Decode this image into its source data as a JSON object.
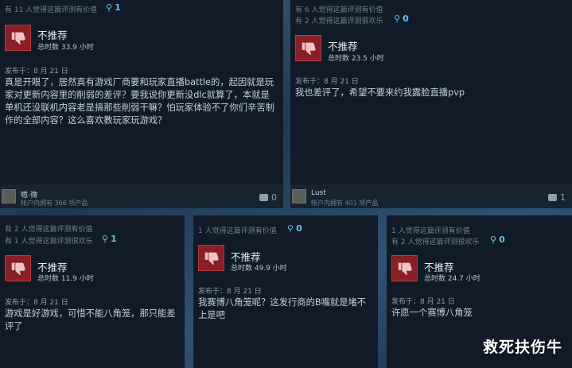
{
  "reviews": [
    {
      "helpful": "有 11 人觉得这篇评测有价值",
      "funny": "",
      "award_count": "1",
      "verdict": "不推荐",
      "hours": "总时数 33.9 小时",
      "posted": "发布于：8 月 21 日",
      "text": "真是开眼了，居然真有游戏厂商要和玩家直播battle的，起因就是玩家对更新内容里的削弱的差评？要我说你更新没dlc就算了，本就是单机还没联机内容老是搞那些削弱干嘛？怕玩家体验不了你们辛苦制作的全部内容？这么喜欢教玩家玩游戏？",
      "username": "噫-微",
      "owned": "帐户内拥有 366 项产品",
      "comments": "0"
    },
    {
      "helpful": "有 6 人觉得这篇评测有价值",
      "funny": "有 2 人觉得这篇评测很欢乐",
      "award_count": "0",
      "verdict": "不推荐",
      "hours": "总时数 23.5 小时",
      "posted": "发布于：8 月 21 日",
      "text": "我也差评了，希望不要来约我露脸直播pvp",
      "username": "Lust",
      "owned": "帐户内拥有 401 项产品",
      "comments": "1"
    },
    {
      "helpful": "有 2 人觉得这篇评测有价值",
      "funny": "有 1 人觉得这篇评测很欢乐",
      "award_count": "1",
      "verdict": "不推荐",
      "hours": "总时数 11.9 小时",
      "posted": "发布于：8 月 21 日",
      "text": "游戏是好游戏，可惜不能八角笼，那只能差评了"
    },
    {
      "helpful": "1 人觉得这篇评测有价值",
      "funny": "",
      "award_count": "0",
      "verdict": "不推荐",
      "hours": "总时数 49.9 小时",
      "posted": "发布于：8 月 21 日",
      "text": "我赛博八角笼呢？这发行商的B嘴就是堵不上是吧"
    },
    {
      "helpful": "1 人觉得这篇评测有价值",
      "funny": "有 2 人觉得这篇评测很欢乐",
      "award_count": "0",
      "verdict": "不推荐",
      "hours": "总时数 24.7 小时",
      "posted": "发布于：8 月 21 日",
      "text": "许愿一个赛博八角笼"
    }
  ],
  "watermark": "救死扶伤牛",
  "colors": {
    "accent": "#66c0f4",
    "thumb_down": "#8a1f25",
    "card_bg": "#101b27"
  },
  "icons": {
    "thumb": "thumbs-down-icon",
    "award": "award-icon",
    "comment": "comment-icon"
  }
}
